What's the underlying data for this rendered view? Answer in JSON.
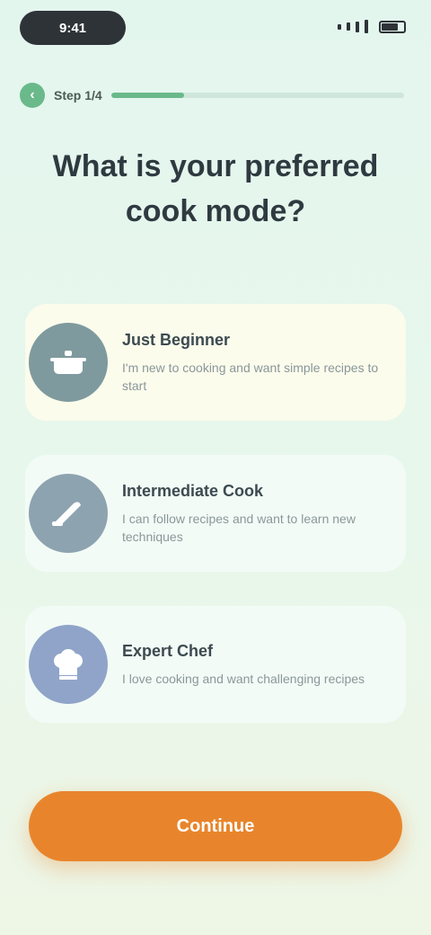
{
  "status_bar": {
    "time": "9:41"
  },
  "progress": {
    "back_icon": "chevron-left-icon",
    "step_label": "Step 1/4",
    "fraction": 0.25,
    "color": "#6ab98a"
  },
  "title": "What is your preferred cook mode?",
  "options": [
    {
      "icon": "pot-icon",
      "icon_color": "#7f9a9e",
      "title": "Just Beginner",
      "description": "I'm new to cooking and want simple recipes to start"
    },
    {
      "icon": "knife-icon",
      "icon_color": "#8ea3b0",
      "title": "Intermediate Cook",
      "description": "I can follow recipes and want to learn new techniques"
    },
    {
      "icon": "chef-hat-icon",
      "icon_color": "#8fa4c8",
      "title": "Expert Chef",
      "description": "I love cooking and want challenging recipes"
    }
  ],
  "continue_label": "Continue",
  "accent_color": "#e8852c"
}
